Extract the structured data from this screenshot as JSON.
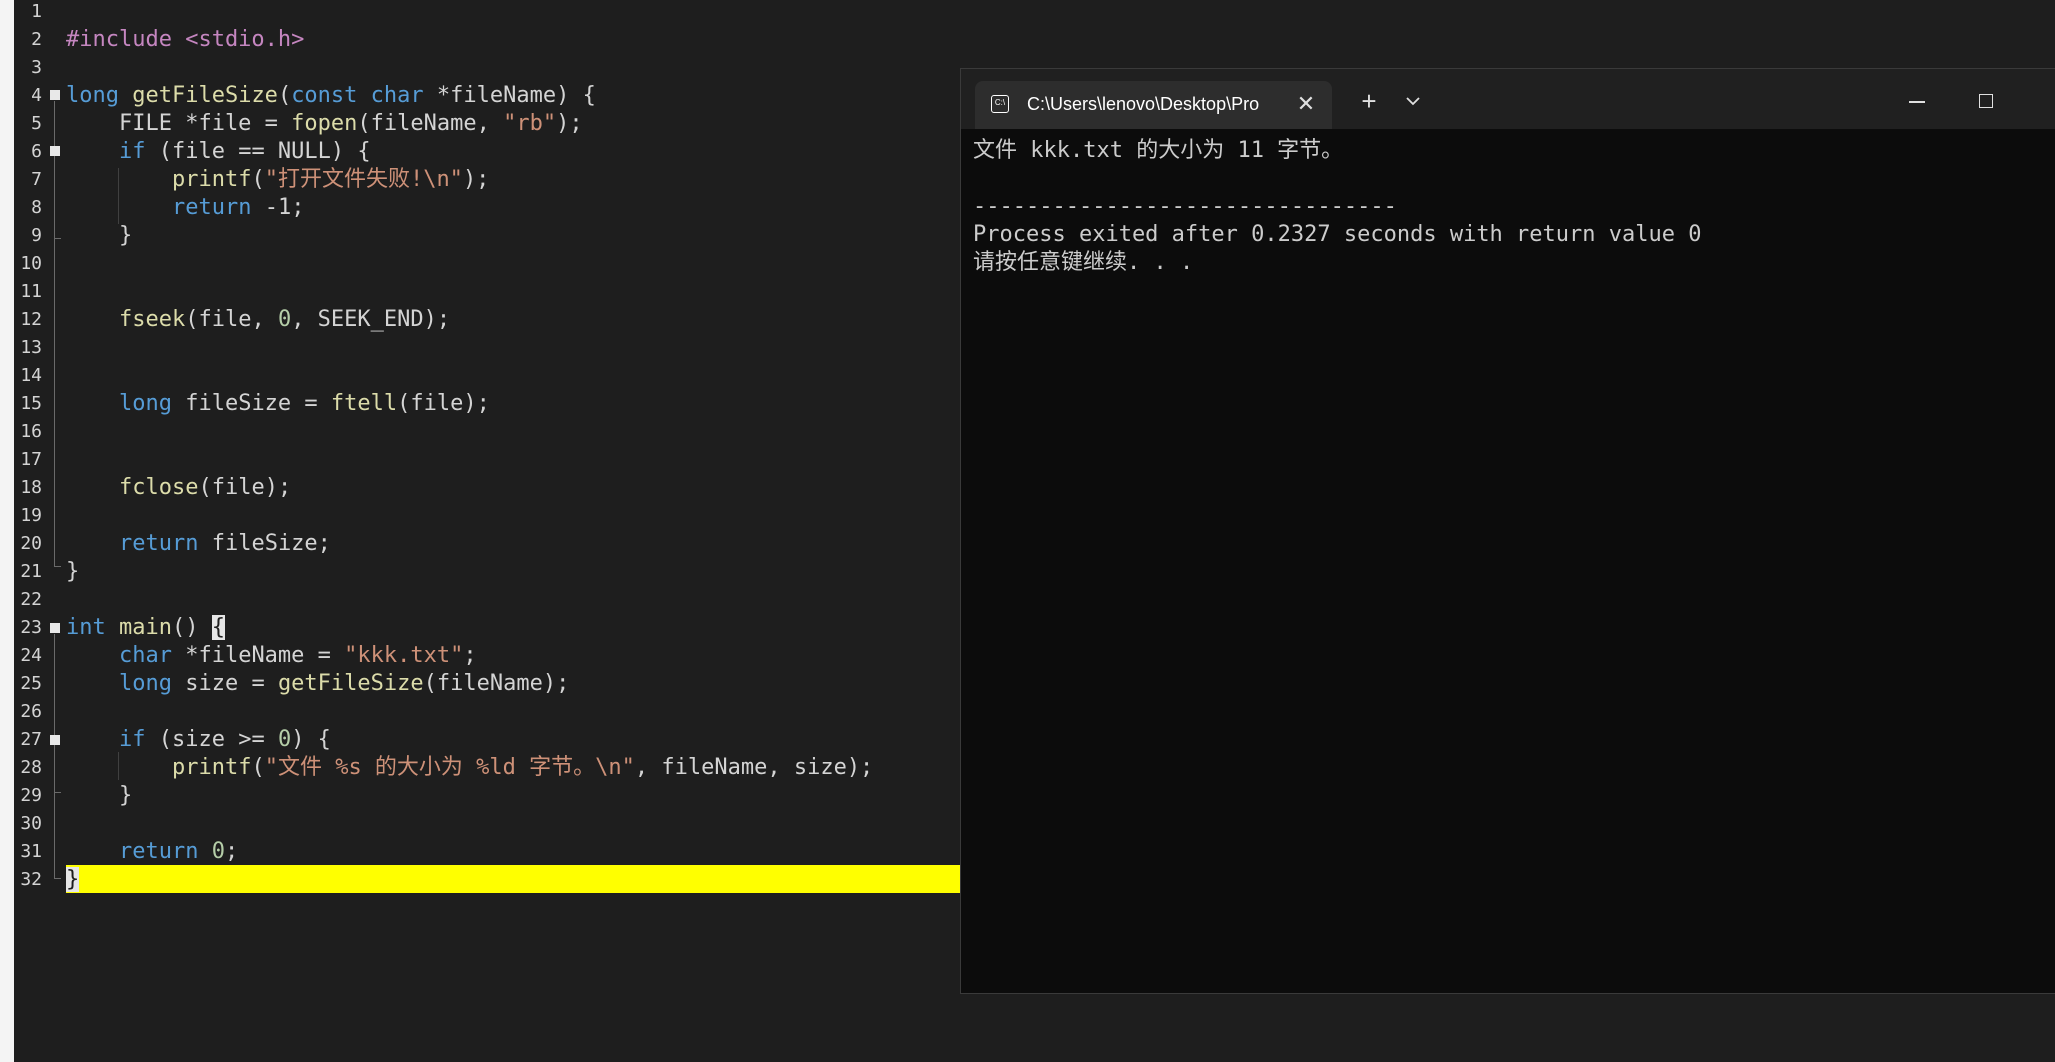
{
  "editor": {
    "line_numbers": [
      "1",
      "2",
      "3",
      "4",
      "5",
      "6",
      "7",
      "8",
      "9",
      "10",
      "11",
      "12",
      "13",
      "14",
      "15",
      "16",
      "17",
      "18",
      "19",
      "20",
      "21",
      "22",
      "23",
      "24",
      "25",
      "26",
      "27",
      "28",
      "29",
      "30",
      "31",
      "32"
    ],
    "code": {
      "l2": {
        "pp": "#include <stdio.h>"
      },
      "l4": {
        "kw1": "long",
        "sp": " ",
        "fn": "getFileSize",
        "p1": "(",
        "kw2": "const char",
        "rest": " *fileName) {"
      },
      "l5": {
        "a": "    FILE *file = ",
        "fn": "fopen",
        "b": "(fileName, ",
        "str": "\"rb\"",
        "c": ");"
      },
      "l6": {
        "ind": "    ",
        "kw": "if",
        "rest": " (file == NULL) {"
      },
      "l7": {
        "ind": "        ",
        "fn": "printf",
        "p": "(",
        "str": "\"打开文件失败!\\n\"",
        "end": ");"
      },
      "l8": {
        "ind": "        ",
        "kw": "return",
        "rest": " -1;"
      },
      "l9": {
        "text": "    }"
      },
      "l12": {
        "ind": "    ",
        "fn": "fseek",
        "a": "(file, ",
        "num": "0",
        "b": ", SEEK_END);"
      },
      "l15": {
        "ind": "    ",
        "kw": "long",
        "a": " fileSize = ",
        "fn": "ftell",
        "b": "(file);"
      },
      "l18": {
        "ind": "    ",
        "fn": "fclose",
        "b": "(file);"
      },
      "l20": {
        "ind": "    ",
        "kw": "return",
        "rest": " fileSize;"
      },
      "l21": {
        "text": "}"
      },
      "l23": {
        "kw": "int",
        "sp": " ",
        "fn": "main",
        "a": "() ",
        "brace": "{"
      },
      "l24": {
        "ind": "    ",
        "kw": "char",
        "a": " *fileName = ",
        "str": "\"kkk.txt\"",
        "b": ";"
      },
      "l25": {
        "ind": "    ",
        "kw": "long",
        "a": " size = ",
        "fn": "getFileSize",
        "b": "(fileName);"
      },
      "l27": {
        "ind": "    ",
        "kw": "if",
        "a": " (size >= ",
        "num": "0",
        "b": ") {"
      },
      "l28": {
        "ind": "        ",
        "fn": "printf",
        "p": "(",
        "str": "\"文件 %s 的大小为 %ld 字节。\\n\"",
        "end": ", fileName, size);"
      },
      "l29": {
        "text": "    }"
      },
      "l31": {
        "ind": "    ",
        "kw": "return",
        "sp": " ",
        "num": "0",
        "b": ";"
      },
      "l32": {
        "brace": "}"
      }
    },
    "highlight_color": "#ffff00"
  },
  "console": {
    "tab_title": "C:\\Users\\lenovo\\Desktop\\Pro",
    "tab_close": "✕",
    "new_tab": "+",
    "output": [
      "文件 kkk.txt 的大小为 11 字节。",
      "",
      "--------------------------------",
      "Process exited after 0.2327 seconds with return value 0",
      "请按任意键继续. . ."
    ]
  }
}
